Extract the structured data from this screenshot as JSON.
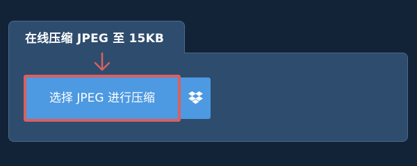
{
  "panel": {
    "title": "在线压缩 JPEG 至 15KB"
  },
  "upload": {
    "select_label": "选择 JPEG 进行压缩",
    "dropbox_icon": "dropbox-icon"
  },
  "colors": {
    "page_bg": "#122338",
    "panel_bg": "#2e4c6d",
    "button_bg": "#4d99e2",
    "highlight": "#d9605f"
  }
}
